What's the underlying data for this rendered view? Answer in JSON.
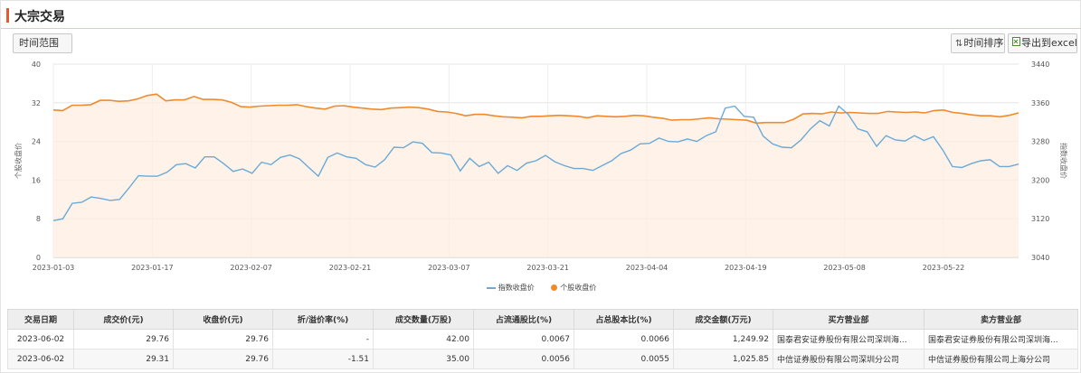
{
  "header": {
    "title": "大宗交易"
  },
  "toolbar": {
    "range_label": "时间范围",
    "sort_label": "时间排序",
    "sort_icon": "sort-arrows-icon",
    "export_label": "导出到excel",
    "export_icon": "excel-file-icon"
  },
  "chart_data": {
    "type": "line",
    "ylabel_left": "个股收盘价",
    "ylabel_right": "指数收盘价",
    "y_left_ticks": [
      "40",
      "32",
      "24",
      "16",
      "8",
      "0"
    ],
    "y_right_ticks": [
      "3440",
      "3360",
      "3280",
      "3200",
      "3120",
      "3040"
    ],
    "ylim_left": [
      0,
      40
    ],
    "ylim_right": [
      3040,
      3440
    ],
    "x_ticks": [
      "2023-01-03",
      "2023-01-17",
      "2023-02-07",
      "2023-02-21",
      "2023-03-07",
      "2023-03-21",
      "2023-04-04",
      "2023-04-19",
      "2023-05-08",
      "2023-05-22"
    ],
    "grid": true,
    "legend_position": "bottom",
    "series": [
      {
        "name": "指数收盘价",
        "axis": "right",
        "color": "#6aaad8",
        "values": [
          3116,
          3120,
          3152,
          3154,
          3165,
          3162,
          3158,
          3160,
          3184,
          3209,
          3208,
          3208,
          3216,
          3232,
          3234,
          3225,
          3248,
          3248,
          3234,
          3218,
          3223,
          3214,
          3237,
          3232,
          3247,
          3252,
          3244,
          3226,
          3208,
          3247,
          3256,
          3248,
          3245,
          3232,
          3227,
          3242,
          3268,
          3267,
          3279,
          3276,
          3257,
          3256,
          3252,
          3219,
          3245,
          3228,
          3237,
          3214,
          3230,
          3220,
          3235,
          3240,
          3251,
          3238,
          3230,
          3224,
          3224,
          3220,
          3230,
          3240,
          3255,
          3262,
          3275,
          3276,
          3287,
          3280,
          3279,
          3285,
          3280,
          3292,
          3300,
          3349,
          3353,
          3332,
          3330,
          3291,
          3275,
          3268,
          3267,
          3283,
          3306,
          3323,
          3312,
          3353,
          3336,
          3306,
          3300,
          3270,
          3292,
          3283,
          3281,
          3292,
          3282,
          3290,
          3262,
          3228,
          3226,
          3234,
          3240,
          3242,
          3228,
          3228,
          3233
        ]
      },
      {
        "name": "个股收盘价",
        "axis": "left",
        "color": "#f08a2c",
        "values": [
          30.5,
          30.4,
          31.5,
          31.5,
          31.6,
          32.5,
          32.5,
          32.3,
          32.4,
          32.8,
          33.5,
          33.8,
          32.4,
          32.6,
          32.6,
          33.3,
          32.7,
          32.7,
          32.6,
          32.1,
          31.2,
          31.1,
          31.3,
          31.4,
          31.5,
          31.5,
          31.6,
          31.2,
          30.9,
          30.7,
          31.3,
          31.4,
          31.1,
          30.9,
          30.7,
          30.6,
          30.9,
          31.0,
          31.1,
          31.0,
          30.7,
          30.2,
          30.1,
          29.8,
          29.3,
          29.6,
          29.6,
          29.3,
          29.1,
          29.0,
          28.9,
          29.2,
          29.2,
          29.3,
          29.4,
          29.3,
          29.2,
          28.9,
          29.3,
          29.2,
          29.1,
          29.2,
          29.4,
          29.3,
          29.0,
          28.8,
          28.4,
          28.5,
          28.5,
          28.7,
          28.9,
          28.7,
          28.6,
          28.5,
          28.4,
          27.8,
          27.9,
          27.9,
          27.9,
          28.6,
          29.7,
          29.8,
          29.7,
          30.1,
          29.9,
          30.0,
          29.9,
          29.8,
          29.8,
          30.2,
          30.1,
          30.0,
          30.1,
          29.9,
          30.4,
          30.5,
          30.0,
          29.8,
          29.5,
          29.3,
          29.3,
          29.1,
          29.4,
          29.9
        ]
      }
    ]
  },
  "table": {
    "columns": [
      "交易日期",
      "成交价(元)",
      "收盘价(元)",
      "折/溢价率(%)",
      "成交数量(万股)",
      "占流通股比(%)",
      "占总股本比(%)",
      "成交金额(万元)",
      "买方营业部",
      "卖方营业部"
    ],
    "rows": [
      [
        "2023-06-02",
        "29.76",
        "29.76",
        "-",
        "42.00",
        "0.0067",
        "0.0066",
        "1,249.92",
        "国泰君安证券股份有限公司深圳海...",
        "国泰君安证券股份有限公司深圳海..."
      ],
      [
        "2023-06-02",
        "29.31",
        "29.76",
        "-1.51",
        "35.00",
        "0.0056",
        "0.0055",
        "1,025.85",
        "中信证券股份有限公司深圳分公司",
        "中信证券股份有限公司上海分公司"
      ]
    ]
  }
}
